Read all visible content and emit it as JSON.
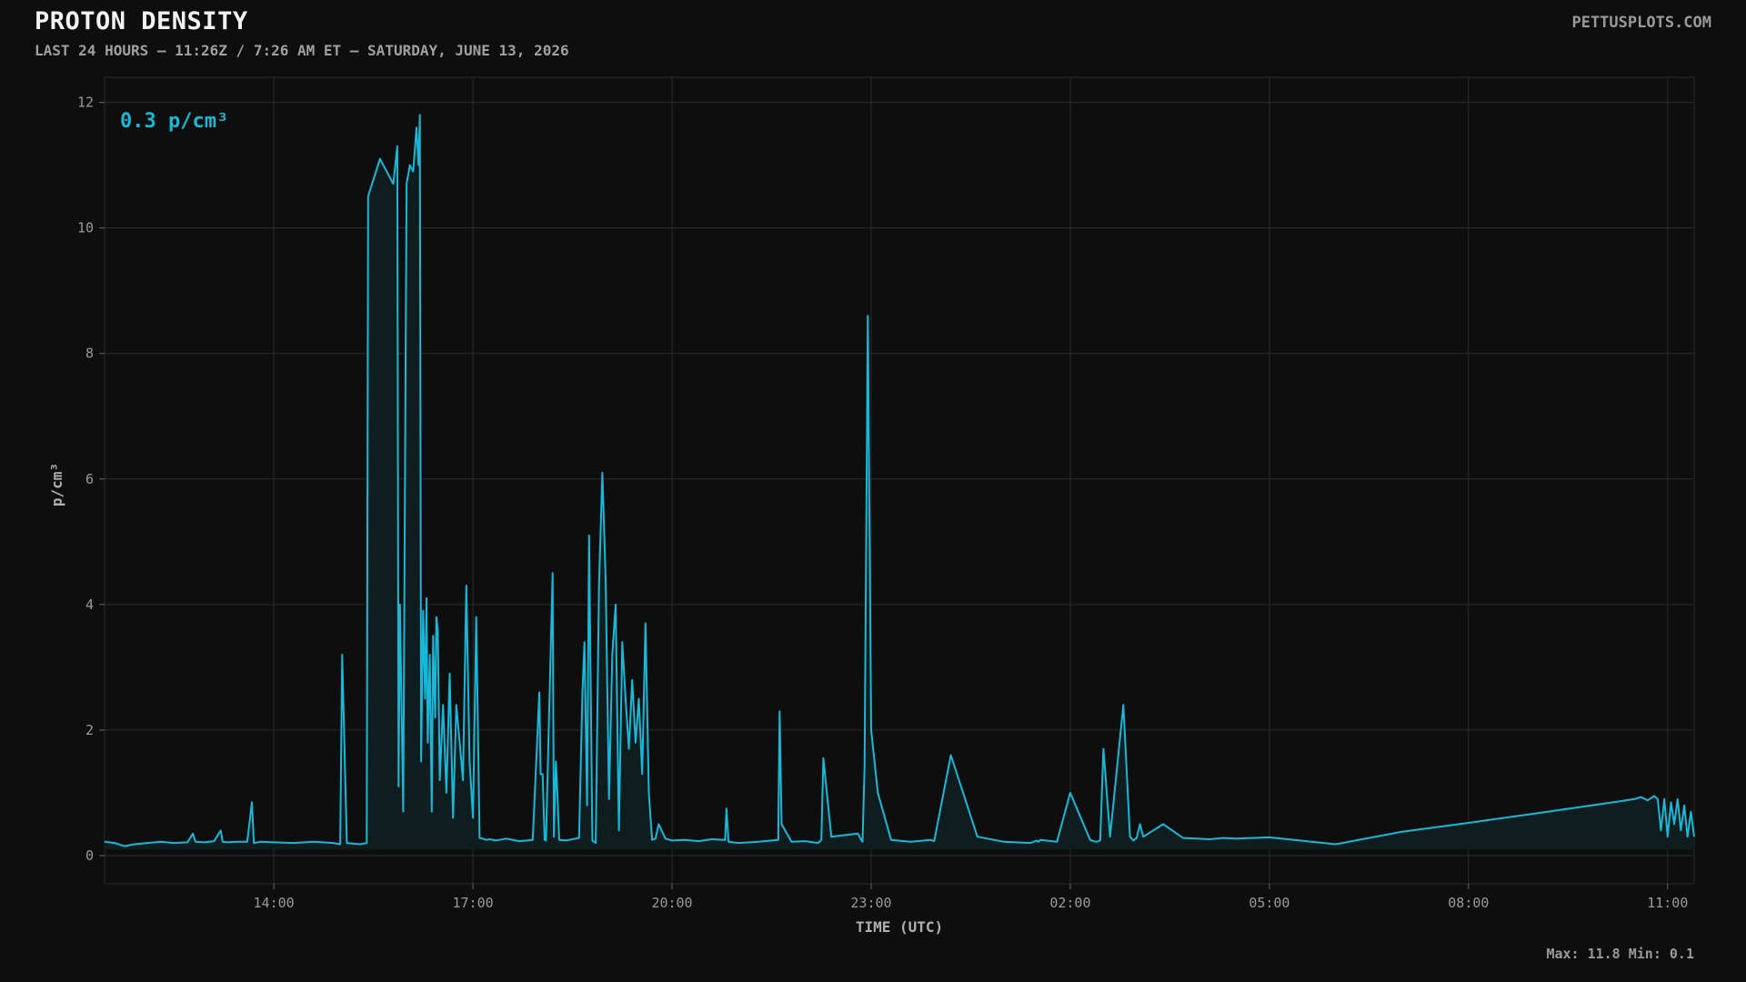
{
  "header": {
    "title": "PROTON DENSITY",
    "subtitle": "LAST 24 HOURS — 11:26Z / 7:26 AM ET — SATURDAY, JUNE 13, 2026",
    "brand": "PETTUSPLOTS.COM"
  },
  "current_value": "0.3 p/cm³",
  "stats_text": "Max: 11.8  Min: 0.1",
  "colors": {
    "background": "#0e0e0e",
    "line": "#19b8d8",
    "fill": "#0f1d1f",
    "grid": "#2c2c2c"
  },
  "chart_data": {
    "type": "area",
    "title": "PROTON DENSITY",
    "xlabel": "TIME (UTC)",
    "ylabel": "p/cm³",
    "x_unit": "hours",
    "xlim": [
      11.45,
      35.4
    ],
    "ylim": [
      -0.45,
      12.4
    ],
    "y_ticks": [
      0,
      2,
      4,
      6,
      8,
      10,
      12
    ],
    "x_ticks": [
      {
        "x": 14,
        "label": "14:00"
      },
      {
        "x": 17,
        "label": "17:00"
      },
      {
        "x": 20,
        "label": "20:00"
      },
      {
        "x": 23,
        "label": "23:00"
      },
      {
        "x": 26,
        "label": "02:00"
      },
      {
        "x": 29,
        "label": "05:00"
      },
      {
        "x": 32,
        "label": "08:00"
      },
      {
        "x": 35,
        "label": "11:00"
      }
    ],
    "grid": true,
    "max": 11.8,
    "min": 0.1,
    "series": [
      {
        "x": [
          11.45,
          11.6,
          11.75,
          11.9,
          12.1,
          12.3,
          12.5,
          12.7,
          12.78,
          12.82,
          12.95,
          13.1,
          13.2,
          13.23,
          13.3,
          13.45,
          13.6,
          13.67,
          13.7,
          13.8,
          14.0,
          14.3,
          14.6,
          14.9,
          15.0,
          15.03,
          15.1,
          15.3,
          15.4,
          15.42,
          15.45,
          15.6,
          15.8,
          15.86,
          15.88,
          15.9,
          15.95,
          16.0,
          16.05,
          16.1,
          16.15,
          16.18,
          16.2,
          16.22,
          16.25,
          16.28,
          16.3,
          16.32,
          16.35,
          16.38,
          16.4,
          16.43,
          16.45,
          16.47,
          16.5,
          16.55,
          16.6,
          16.65,
          16.7,
          16.75,
          16.8,
          16.85,
          16.9,
          16.95,
          17.0,
          17.05,
          17.1,
          17.15,
          17.2,
          17.25,
          17.3,
          17.35,
          17.4,
          17.5,
          17.7,
          17.9,
          18.0,
          18.02,
          18.05,
          18.08,
          18.1,
          18.2,
          18.22,
          18.25,
          18.28,
          18.3,
          18.4,
          18.6,
          18.65,
          18.68,
          18.72,
          18.75,
          18.8,
          18.85,
          18.9,
          18.95,
          19.0,
          19.05,
          19.1,
          19.15,
          19.2,
          19.25,
          19.3,
          19.35,
          19.4,
          19.45,
          19.5,
          19.55,
          19.6,
          19.65,
          19.7,
          19.75,
          19.8,
          19.9,
          20.0,
          20.2,
          20.4,
          20.6,
          20.8,
          20.82,
          20.85,
          21.0,
          21.3,
          21.6,
          21.62,
          21.65,
          21.8,
          22.0,
          22.2,
          22.25,
          22.28,
          22.4,
          22.8,
          22.85,
          22.87,
          22.9,
          22.95,
          23.0,
          23.1,
          23.3,
          23.6,
          23.9,
          23.92,
          23.95,
          24.2,
          24.6,
          25.0,
          25.4,
          25.5,
          25.52,
          25.55,
          25.8,
          26.0,
          26.3,
          26.35,
          26.4,
          26.45,
          26.5,
          26.6,
          26.8,
          26.9,
          26.95,
          27.0,
          27.05,
          27.1,
          27.4,
          27.7,
          27.9,
          28.1,
          28.3,
          28.5,
          29.0,
          30.0,
          31.0,
          32.0,
          33.0,
          34.0,
          34.5,
          34.6,
          34.7,
          34.8,
          34.85,
          34.9,
          34.95,
          35.0,
          35.05,
          35.1,
          35.15,
          35.2,
          35.25,
          35.3,
          35.35,
          35.4
        ],
        "y": [
          0.22,
          0.2,
          0.15,
          0.18,
          0.2,
          0.22,
          0.2,
          0.21,
          0.35,
          0.22,
          0.21,
          0.23,
          0.4,
          0.22,
          0.21,
          0.22,
          0.22,
          0.85,
          0.2,
          0.22,
          0.21,
          0.2,
          0.22,
          0.2,
          0.18,
          3.2,
          0.2,
          0.18,
          0.2,
          10.5,
          10.6,
          11.1,
          10.7,
          11.3,
          1.1,
          4.0,
          0.7,
          10.7,
          11.0,
          10.9,
          11.6,
          11.0,
          11.8,
          1.5,
          3.9,
          2.5,
          4.1,
          1.8,
          3.2,
          0.7,
          3.5,
          2.2,
          3.8,
          3.6,
          1.2,
          2.4,
          1.0,
          2.9,
          0.6,
          2.4,
          1.8,
          1.2,
          4.3,
          1.5,
          0.6,
          3.8,
          0.28,
          0.27,
          0.25,
          0.26,
          0.25,
          0.24,
          0.25,
          0.27,
          0.23,
          0.25,
          2.6,
          1.3,
          1.3,
          0.25,
          0.24,
          4.5,
          0.3,
          1.5,
          0.8,
          0.25,
          0.24,
          0.28,
          2.6,
          3.4,
          0.8,
          5.1,
          0.24,
          0.2,
          4.3,
          6.1,
          4.4,
          0.9,
          3.2,
          4.0,
          0.4,
          3.4,
          2.5,
          1.7,
          2.8,
          1.8,
          2.5,
          1.3,
          3.7,
          1.0,
          0.25,
          0.27,
          0.5,
          0.27,
          0.24,
          0.25,
          0.23,
          0.26,
          0.25,
          0.75,
          0.22,
          0.2,
          0.22,
          0.25,
          2.3,
          0.5,
          0.22,
          0.23,
          0.2,
          0.25,
          1.55,
          0.3,
          0.35,
          0.25,
          0.22,
          1.4,
          8.6,
          2.0,
          1.0,
          0.25,
          0.22,
          0.25,
          0.24,
          0.23,
          1.6,
          0.3,
          0.22,
          0.2,
          0.24,
          0.22,
          0.25,
          0.22,
          1.0,
          0.25,
          0.23,
          0.22,
          0.24,
          1.7,
          0.3,
          2.4,
          0.3,
          0.24,
          0.28,
          0.5,
          0.3,
          0.5,
          0.28,
          0.27,
          0.26,
          0.28,
          0.27,
          0.29,
          0.18,
          0.38,
          0.52,
          0.67,
          0.82,
          0.9,
          0.93,
          0.88,
          0.95,
          0.9,
          0.4,
          0.9,
          0.3,
          0.85,
          0.5,
          0.9,
          0.4,
          0.8,
          0.3,
          0.7,
          0.3
        ]
      }
    ]
  }
}
